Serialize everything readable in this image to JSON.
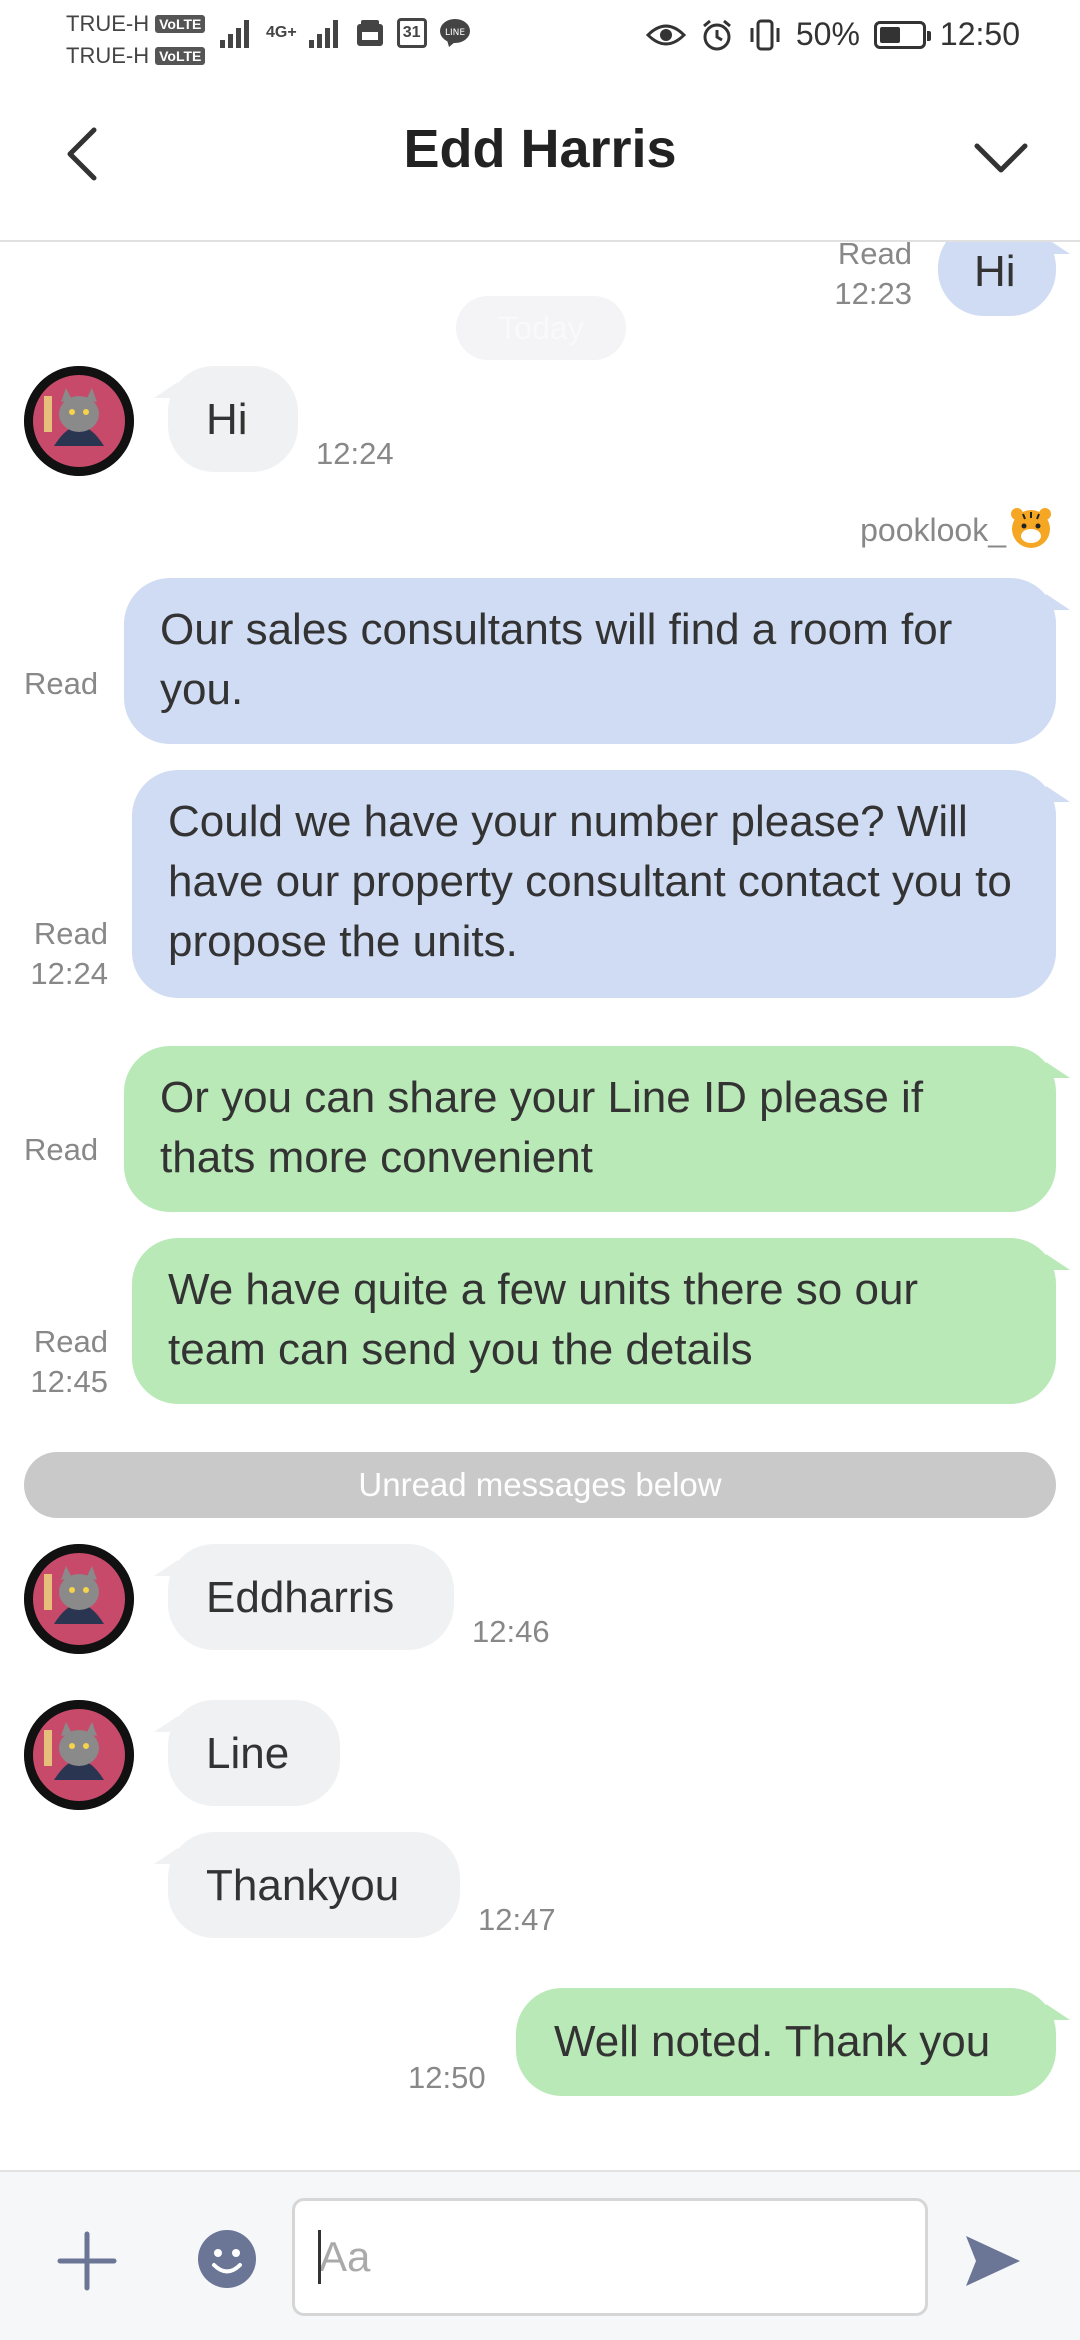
{
  "status_bar": {
    "carrier_1": "TRUE-H",
    "carrier_2": "TRUE-H",
    "volte": "VoLTE",
    "network": "4G+",
    "calendar_day": "31",
    "battery_percent": "50%",
    "battery_level": 0.5,
    "time": "12:50"
  },
  "header": {
    "title": "Edd Harris"
  },
  "chat": {
    "date_separator": "Today",
    "sender_label": "pooklook_",
    "unread_separator": "Unread messages below",
    "messages": [
      {
        "from": "me",
        "text": "Hi",
        "status": "Read",
        "time": "12:23"
      },
      {
        "from": "them",
        "text": "Hi",
        "time": "12:24"
      },
      {
        "from": "me",
        "text": "Our sales consultants will find a room for you.",
        "status": "Read",
        "time": ""
      },
      {
        "from": "me",
        "text": "Could we have your number please? Will have our property consultant contact you to propose the units.",
        "status": "Read",
        "time": "12:24"
      },
      {
        "from": "me",
        "text": "Or you can share your Line ID please if thats more convenient",
        "status": "Read",
        "time": ""
      },
      {
        "from": "me",
        "text": "We have quite a few units there so our team can send you the details",
        "status": "Read",
        "time": "12:45"
      },
      {
        "from": "them",
        "text": "Eddharris",
        "time": "12:46"
      },
      {
        "from": "them",
        "text": "Line",
        "time": ""
      },
      {
        "from": "them",
        "text": "Thankyou",
        "time": "12:47"
      },
      {
        "from": "me",
        "text": "Well noted. Thank you",
        "status": "",
        "time": "12:50"
      }
    ]
  },
  "input": {
    "placeholder": "Aa",
    "value": ""
  },
  "colors": {
    "bubble_blue": "#d0dcf3",
    "bubble_green": "#b9e9b7",
    "bubble_grey": "#f0f1f3",
    "accent_icon": "#6b7596"
  }
}
